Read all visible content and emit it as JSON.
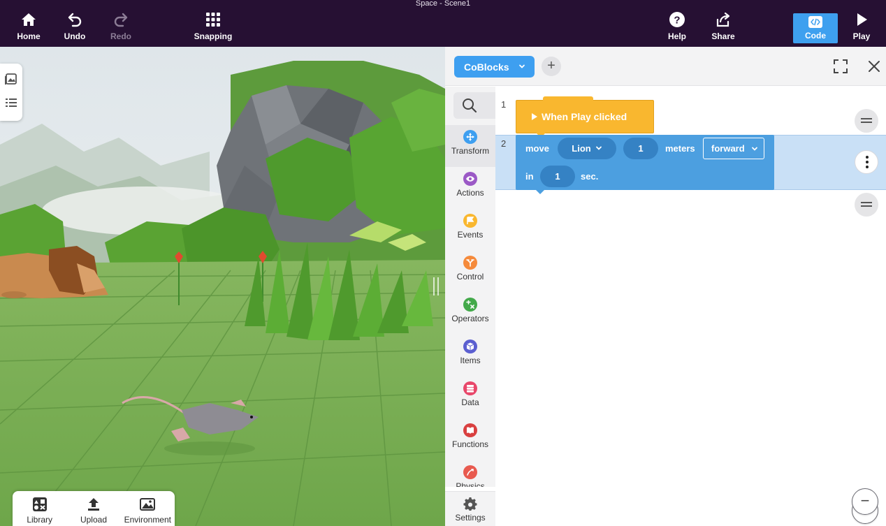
{
  "window": {
    "title": "Space - Scene1"
  },
  "toolbar": {
    "home": "Home",
    "undo": "Undo",
    "redo": "Redo",
    "snapping": "Snapping",
    "help": "Help",
    "share": "Share",
    "code": "Code",
    "play": "Play"
  },
  "viewport": {
    "tray": {
      "library": "Library",
      "upload": "Upload",
      "environment": "Environment"
    },
    "side_tab_icons": [
      "gallery-icon",
      "list-icon"
    ]
  },
  "code_panel": {
    "language": "CoBlocks",
    "add_tab": "+",
    "categories": [
      {
        "label": "Transform",
        "color": "#3e9ff0",
        "icon": "transform-icon"
      },
      {
        "label": "Actions",
        "color": "#9b59c6",
        "icon": "eye-icon"
      },
      {
        "label": "Events",
        "color": "#f9b72f",
        "icon": "flag-icon"
      },
      {
        "label": "Control",
        "color": "#f58a3b",
        "icon": "fork-icon"
      },
      {
        "label": "Operators",
        "color": "#43a94a",
        "icon": "operators-icon"
      },
      {
        "label": "Items",
        "color": "#5b5fd0",
        "icon": "cube-icon"
      },
      {
        "label": "Data",
        "color": "#e8476a",
        "icon": "database-icon"
      },
      {
        "label": "Functions",
        "color": "#d94040",
        "icon": "book-icon"
      },
      {
        "label": "Physics",
        "color": "#e85a4f",
        "icon": "physics-icon"
      }
    ],
    "settings": "Settings",
    "lines": [
      "1",
      "2"
    ],
    "event_block": {
      "text": "When Play clicked"
    },
    "move_block": {
      "move": "move",
      "target": "Lion",
      "distance": "1",
      "unit": "meters",
      "direction": "forward",
      "in": "in",
      "duration": "1",
      "sec": "sec."
    },
    "zoom": {
      "in": "+",
      "out": "−"
    }
  }
}
